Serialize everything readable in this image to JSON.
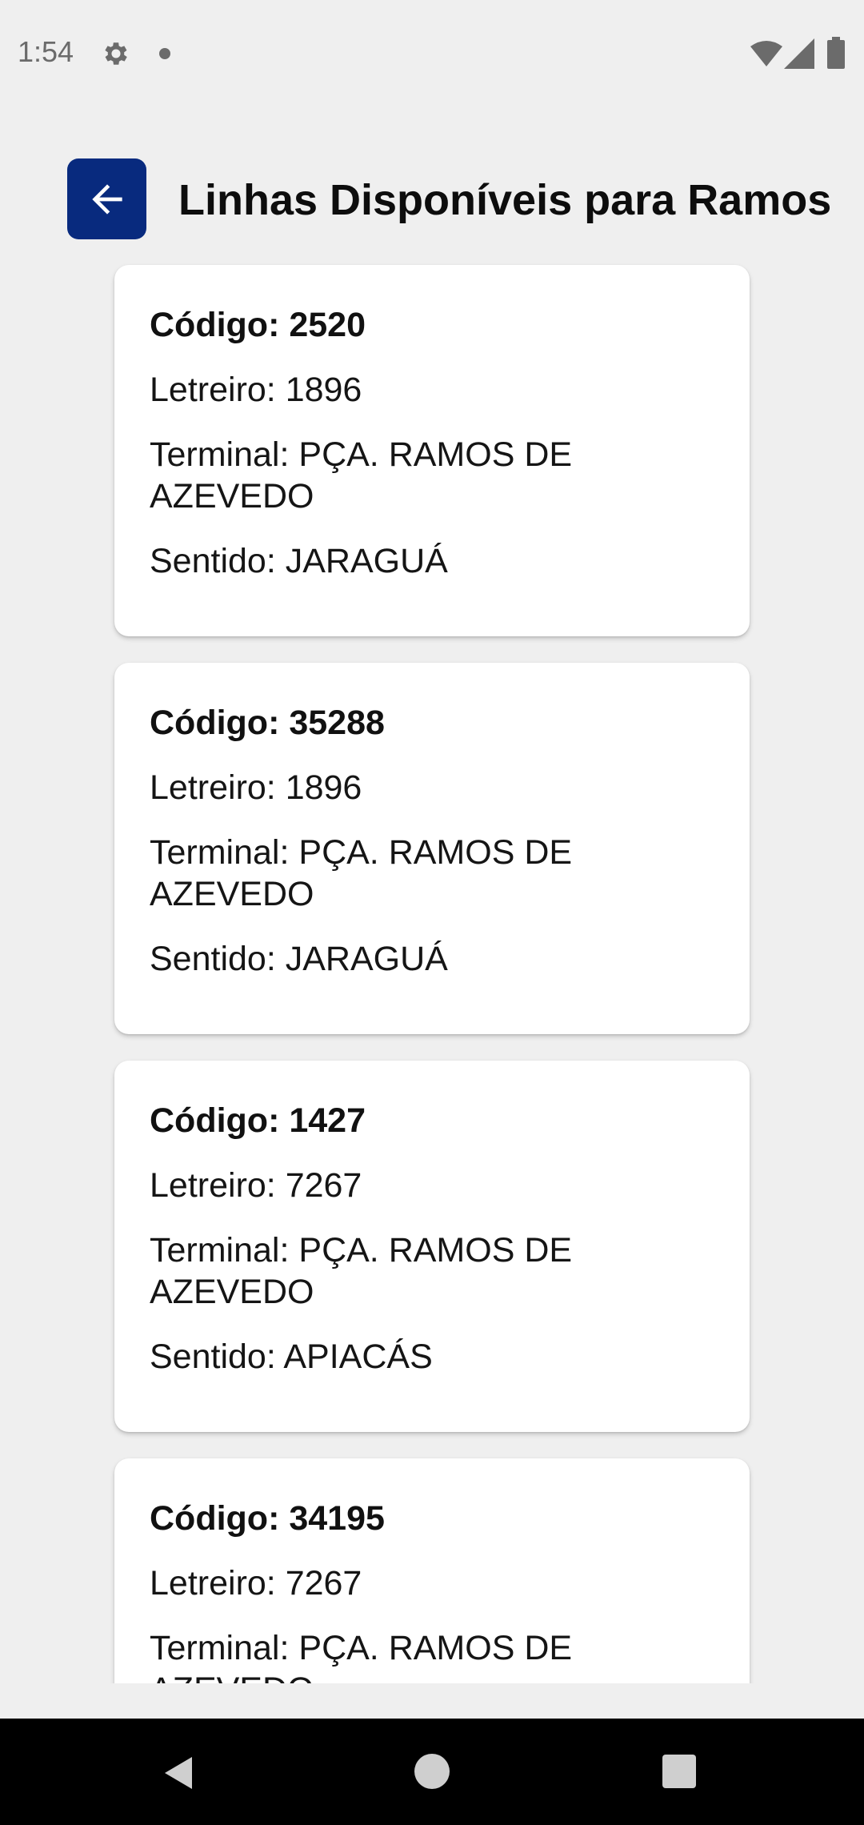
{
  "status_bar": {
    "time": "1:54",
    "icons": [
      "gear-icon",
      "notification-dot",
      "wifi-icon",
      "cell-signal-icon",
      "battery-icon"
    ]
  },
  "header": {
    "title": "Linhas Disponíveis para Ramos",
    "back_icon": "arrow-left-icon",
    "accent_color": "#082a7e"
  },
  "lines": [
    {
      "code": "Código: 2520",
      "sign": "Letreiro: 1896",
      "terminal_1": "Terminal: PÇA. RAMOS DE",
      "terminal_2": "AZEVEDO",
      "direction": "Sentido: JARAGUÁ"
    },
    {
      "code": "Código: 35288",
      "sign": "Letreiro: 1896",
      "terminal_1": "Terminal: PÇA. RAMOS DE",
      "terminal_2": "AZEVEDO",
      "direction": "Sentido: JARAGUÁ"
    },
    {
      "code": "Código: 1427",
      "sign": "Letreiro: 7267",
      "terminal_1": "Terminal: PÇA. RAMOS DE",
      "terminal_2": "AZEVEDO",
      "direction": "Sentido: APIACÁS"
    },
    {
      "code": "Código: 34195",
      "sign": "Letreiro: 7267",
      "terminal_1": "Terminal: PÇA. RAMOS DE",
      "terminal_2": "AZEVEDO",
      "direction": ""
    }
  ],
  "nav_bar": {
    "icons": [
      "nav-back-icon",
      "nav-home-icon",
      "nav-recents-icon"
    ]
  }
}
